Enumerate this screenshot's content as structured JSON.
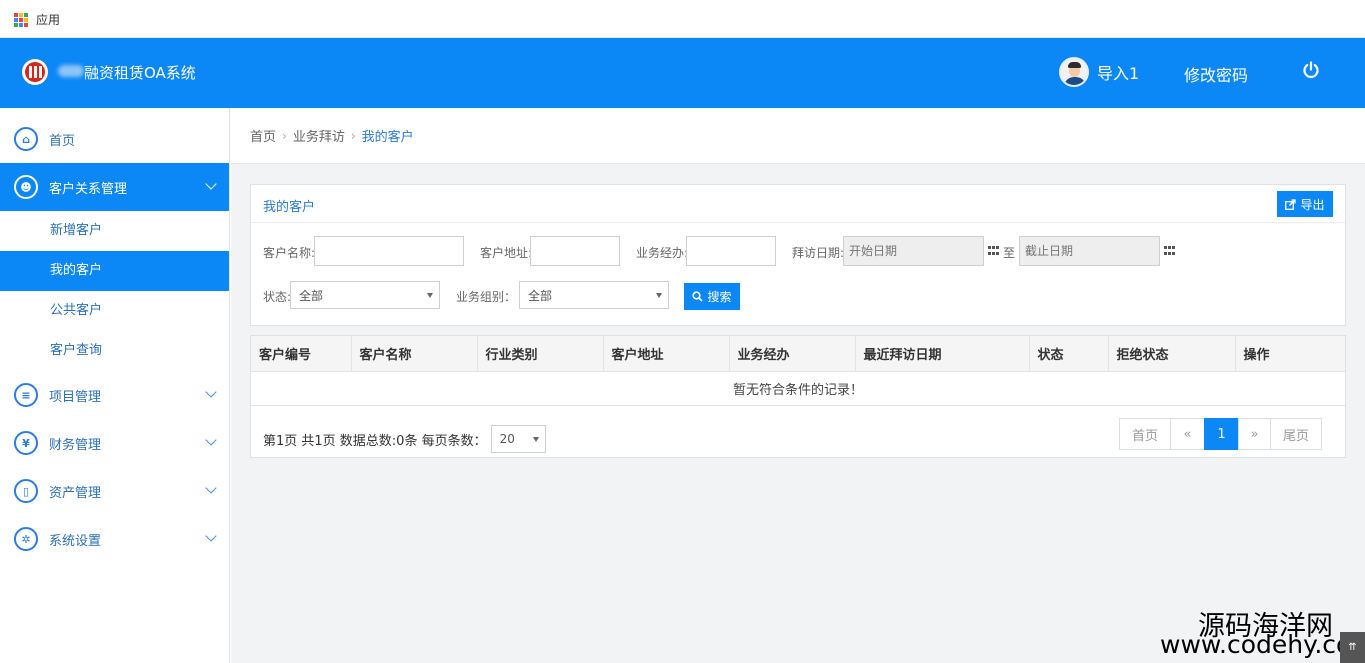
{
  "bookmarks": {
    "apps_label": "应用"
  },
  "header": {
    "brand": "融资租赁OA系统",
    "user_name": "导入1",
    "change_password": "修改密码"
  },
  "sidebar": {
    "home": "首页",
    "crm": "客户关系管理",
    "crm_sub": [
      "新增客户",
      "我的客户",
      "公共客户",
      "客户查询"
    ],
    "project": "项目管理",
    "finance": "财务管理",
    "assets": "资产管理",
    "settings": "系统设置"
  },
  "breadcrumb": {
    "home": "首页",
    "visit": "业务拜访",
    "current": "我的客户"
  },
  "panel": {
    "title": "我的客户",
    "export": "导出",
    "customer_name_label": "客户名称:",
    "customer_addr_label": "客户地址:",
    "manager_label": "业务经办:",
    "visit_date_label": "拜访日期:",
    "start_date_placeholder": "开始日期",
    "to": "至",
    "end_date_placeholder": "截止日期",
    "status_label": "状态:",
    "status_value": "全部",
    "group_label": "业务组别：",
    "group_value": "全部",
    "search": "搜索"
  },
  "table": {
    "columns": [
      "客户编号",
      "客户名称",
      "行业类别",
      "客户地址",
      "业务经办",
      "最近拜访日期",
      "状态",
      "拒绝状态",
      "操作"
    ],
    "empty": "暂无符合条件的记录！"
  },
  "pager": {
    "info": "第1页 共1页 数据总数:0条 每页条数：",
    "page_size": "20",
    "first": "首页",
    "prev": "«",
    "current": "1",
    "next": "»",
    "last": "尾页"
  },
  "watermark": {
    "line1": "源码海洋网",
    "line2": "www.codehy.com"
  },
  "colors": {
    "primary": "#0c87f6",
    "link": "#2a7ad8"
  }
}
